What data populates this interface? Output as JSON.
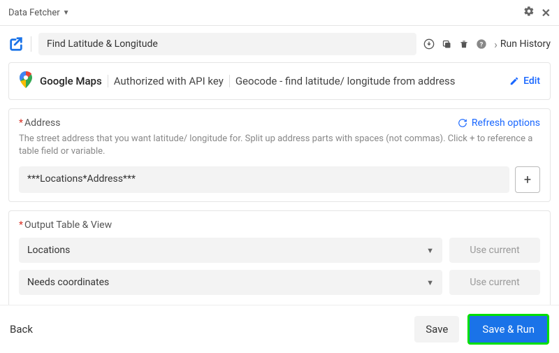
{
  "topbar": {
    "app_name": "Data Fetcher"
  },
  "toolbar": {
    "request_name": "Find Latitude & Longitude",
    "run_history_label": "Run History"
  },
  "source": {
    "service": "Google Maps",
    "auth": "Authorized with API key",
    "endpoint": "Geocode - find latitude/ longitude from address",
    "edit_label": "Edit"
  },
  "address_field": {
    "label": "Address",
    "refresh_label": "Refresh options",
    "help": "The street address that you want latitude/ longitude for. Split up address parts with spaces (not commas). Click + to reference a table field or variable.",
    "value": "***Locations*Address***"
  },
  "output_section": {
    "label": "Output Table & View",
    "table_value": "Locations",
    "view_value": "Needs coordinates",
    "use_current_label": "Use current"
  },
  "footer": {
    "back_label": "Back",
    "save_label": "Save",
    "save_run_label": "Save & Run"
  }
}
